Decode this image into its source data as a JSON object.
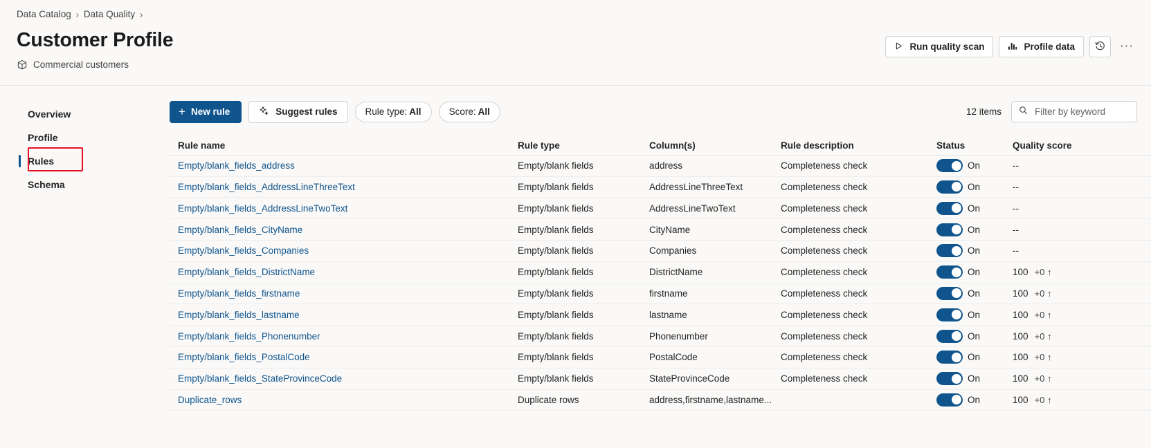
{
  "breadcrumb": {
    "items": [
      "Data Catalog",
      "Data Quality"
    ],
    "separator": "›"
  },
  "header": {
    "title": "Customer Profile",
    "subtitle": "Commercial customers",
    "subtitle_icon": "cube-icon",
    "actions": {
      "run_scan": "Run quality scan",
      "run_scan_icon": "play-triangle-icon",
      "profile_data": "Profile data",
      "profile_data_icon": "bar-chart-icon",
      "history_icon": "history-clock-icon",
      "more_label": "···",
      "more_icon": "more-ellipsis-icon"
    }
  },
  "sidebar": {
    "items": [
      {
        "label": "Overview",
        "selected": false
      },
      {
        "label": "Profile",
        "selected": false
      },
      {
        "label": "Rules",
        "selected": true
      },
      {
        "label": "Schema",
        "selected": false
      }
    ]
  },
  "toolbar": {
    "new_rule": "New rule",
    "new_rule_icon": "plus-icon",
    "suggest_rules": "Suggest rules",
    "suggest_rules_icon": "sparkle-icon",
    "filter_rule_type_prefix": "Rule type:",
    "filter_rule_type_value": "All",
    "filter_score_prefix": "Score:",
    "filter_score_value": "All",
    "items_count": "12 items",
    "search_placeholder": "Filter by keyword",
    "search_value": "",
    "search_icon": "search-icon"
  },
  "table": {
    "columns": [
      "Rule name",
      "Rule type",
      "Column(s)",
      "Rule description",
      "Status",
      "Quality score"
    ],
    "rows": [
      {
        "name": "Empty/blank_fields_address",
        "type": "Empty/blank fields",
        "columns": "address",
        "description": "Completeness check",
        "status": "On",
        "status_on": true,
        "score": "--",
        "delta": ""
      },
      {
        "name": "Empty/blank_fields_AddressLineThreeText",
        "type": "Empty/blank fields",
        "columns": "AddressLineThreeText",
        "description": "Completeness check",
        "status": "On",
        "status_on": true,
        "score": "--",
        "delta": ""
      },
      {
        "name": "Empty/blank_fields_AddressLineTwoText",
        "type": "Empty/blank fields",
        "columns": "AddressLineTwoText",
        "description": "Completeness check",
        "status": "On",
        "status_on": true,
        "score": "--",
        "delta": ""
      },
      {
        "name": "Empty/blank_fields_CityName",
        "type": "Empty/blank fields",
        "columns": "CityName",
        "description": "Completeness check",
        "status": "On",
        "status_on": true,
        "score": "--",
        "delta": ""
      },
      {
        "name": "Empty/blank_fields_Companies",
        "type": "Empty/blank fields",
        "columns": "Companies",
        "description": "Completeness check",
        "status": "On",
        "status_on": true,
        "score": "--",
        "delta": ""
      },
      {
        "name": "Empty/blank_fields_DistrictName",
        "type": "Empty/blank fields",
        "columns": "DistrictName",
        "description": "Completeness check",
        "status": "On",
        "status_on": true,
        "score": "100",
        "delta": "+0 ↑"
      },
      {
        "name": "Empty/blank_fields_firstname",
        "type": "Empty/blank fields",
        "columns": "firstname",
        "description": "Completeness check",
        "status": "On",
        "status_on": true,
        "score": "100",
        "delta": "+0 ↑"
      },
      {
        "name": "Empty/blank_fields_lastname",
        "type": "Empty/blank fields",
        "columns": "lastname",
        "description": "Completeness check",
        "status": "On",
        "status_on": true,
        "score": "100",
        "delta": "+0 ↑"
      },
      {
        "name": "Empty/blank_fields_Phonenumber",
        "type": "Empty/blank fields",
        "columns": "Phonenumber",
        "description": "Completeness check",
        "status": "On",
        "status_on": true,
        "score": "100",
        "delta": "+0 ↑"
      },
      {
        "name": "Empty/blank_fields_PostalCode",
        "type": "Empty/blank fields",
        "columns": "PostalCode",
        "description": "Completeness check",
        "status": "On",
        "status_on": true,
        "score": "100",
        "delta": "+0 ↑"
      },
      {
        "name": "Empty/blank_fields_StateProvinceCode",
        "type": "Empty/blank fields",
        "columns": "StateProvinceCode",
        "description": "Completeness check",
        "status": "On",
        "status_on": true,
        "score": "100",
        "delta": "+0 ↑"
      },
      {
        "name": "Duplicate_rows",
        "type": "Duplicate rows",
        "columns": "address,firstname,lastname...",
        "description": "",
        "status": "On",
        "status_on": true,
        "score": "100",
        "delta": "+0 ↑"
      }
    ]
  },
  "colors": {
    "accent": "#0f548c",
    "link": "#0f548c",
    "annotation": "#e81123",
    "page_bg": "#faf9f8"
  }
}
